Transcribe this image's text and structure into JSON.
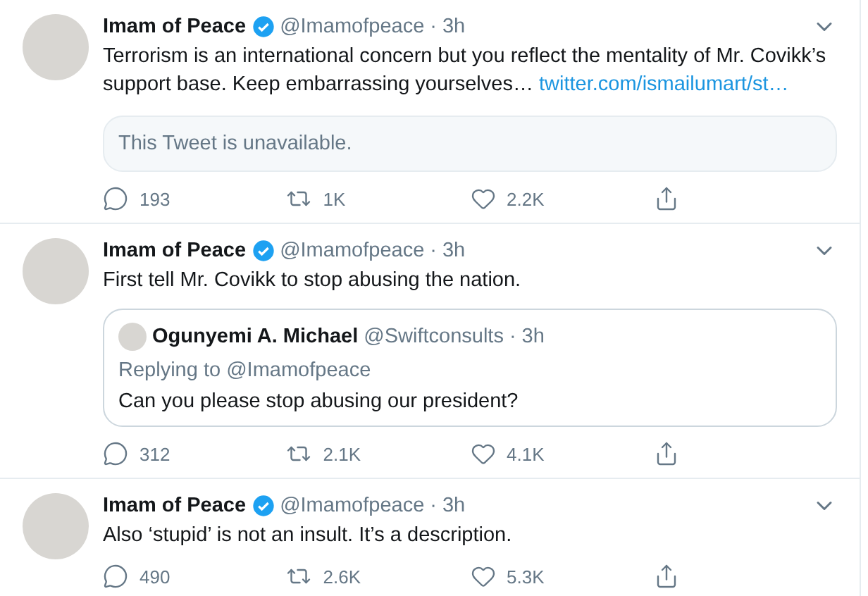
{
  "tweets": [
    {
      "name": "Imam of Peace",
      "verified": true,
      "handle": "@Imamofpeace",
      "time": "3h",
      "separator": "·",
      "text": "Terrorism is an international concern but you reflect the mentality of Mr. Covikk’s support base. Keep embarrassing yourselves…",
      "link": "twitter.com/ismailumart/st…",
      "attachment": {
        "kind": "unavailable",
        "text": "This Tweet is unavailable."
      },
      "replies": "193",
      "retweets": "1K",
      "likes": "2.2K"
    },
    {
      "name": "Imam of Peace",
      "verified": true,
      "handle": "@Imamofpeace",
      "time": "3h",
      "separator": "·",
      "text": "First tell Mr. Covikk to stop abusing the nation.",
      "attachment": {
        "kind": "quote",
        "name": "Ogunyemi A. Michael",
        "handle": "@Swiftconsults",
        "separator": "·",
        "time": "3h",
        "replying": "Replying to @Imamofpeace",
        "text": "Can you please stop abusing our president?"
      },
      "replies": "312",
      "retweets": "2.1K",
      "likes": "4.1K"
    },
    {
      "name": "Imam of Peace",
      "verified": true,
      "handle": "@Imamofpeace",
      "time": "3h",
      "separator": "·",
      "text": "Also ‘stupid’ is not an insult. It’s a description.",
      "replies": "490",
      "retweets": "2.6K",
      "likes": "5.3K"
    }
  ]
}
